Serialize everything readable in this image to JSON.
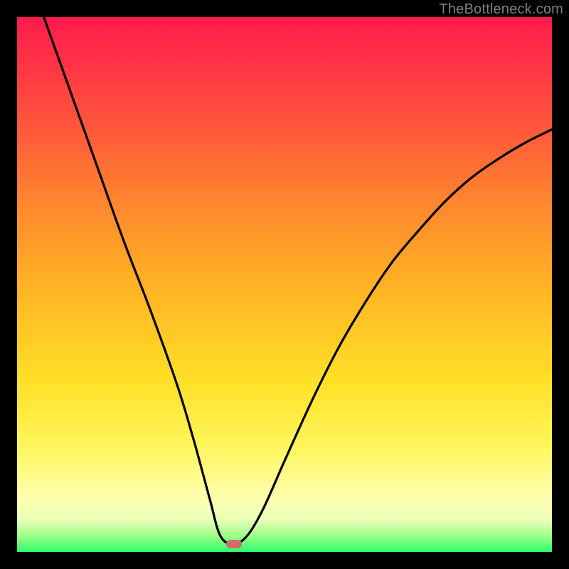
{
  "watermark": "TheBottleneck.com",
  "colors": {
    "frame": "#000000",
    "curve": "#000000",
    "marker": "#d46a6a",
    "gradient_stops": [
      {
        "pos": 0.0,
        "hex": "#ff1a4c"
      },
      {
        "pos": 0.18,
        "hex": "#ff4f3e"
      },
      {
        "pos": 0.36,
        "hex": "#ff8a2d"
      },
      {
        "pos": 0.52,
        "hex": "#ffb724"
      },
      {
        "pos": 0.68,
        "hex": "#ffe027"
      },
      {
        "pos": 0.8,
        "hex": "#fff65a"
      },
      {
        "pos": 0.9,
        "hex": "#ffffb0"
      },
      {
        "pos": 0.94,
        "hex": "#e9ffb8"
      },
      {
        "pos": 0.97,
        "hex": "#9fff8a"
      },
      {
        "pos": 1.0,
        "hex": "#2bfd6c"
      }
    ]
  },
  "chart_data": {
    "type": "line",
    "title": "",
    "xlabel": "",
    "ylabel": "",
    "xlim": [
      0,
      100
    ],
    "ylim": [
      0,
      100
    ],
    "grid": false,
    "legend": false,
    "note": "Axes are unlabeled in the image; x and y are expressed as percentages of plot width/height. y=0 is the bottom (green) edge, y=100 is the top (red) edge.",
    "marker": {
      "x": 40.5,
      "y": 1.5
    },
    "series": [
      {
        "name": "bottleneck-curve",
        "points": [
          {
            "x": 5.0,
            "y": 100.0
          },
          {
            "x": 10.0,
            "y": 86.0
          },
          {
            "x": 15.0,
            "y": 72.0
          },
          {
            "x": 20.0,
            "y": 58.0
          },
          {
            "x": 25.0,
            "y": 45.0
          },
          {
            "x": 30.0,
            "y": 31.0
          },
          {
            "x": 33.0,
            "y": 21.0
          },
          {
            "x": 36.0,
            "y": 10.0
          },
          {
            "x": 38.0,
            "y": 3.0
          },
          {
            "x": 40.5,
            "y": 1.5
          },
          {
            "x": 43.0,
            "y": 3.0
          },
          {
            "x": 46.0,
            "y": 8.0
          },
          {
            "x": 50.0,
            "y": 17.0
          },
          {
            "x": 55.0,
            "y": 28.0
          },
          {
            "x": 60.0,
            "y": 38.0
          },
          {
            "x": 65.0,
            "y": 46.5
          },
          {
            "x": 70.0,
            "y": 54.0
          },
          {
            "x": 75.0,
            "y": 60.0
          },
          {
            "x": 80.0,
            "y": 65.5
          },
          {
            "x": 85.0,
            "y": 70.0
          },
          {
            "x": 90.0,
            "y": 73.5
          },
          {
            "x": 95.0,
            "y": 76.5
          },
          {
            "x": 100.0,
            "y": 79.0
          }
        ]
      }
    ]
  }
}
